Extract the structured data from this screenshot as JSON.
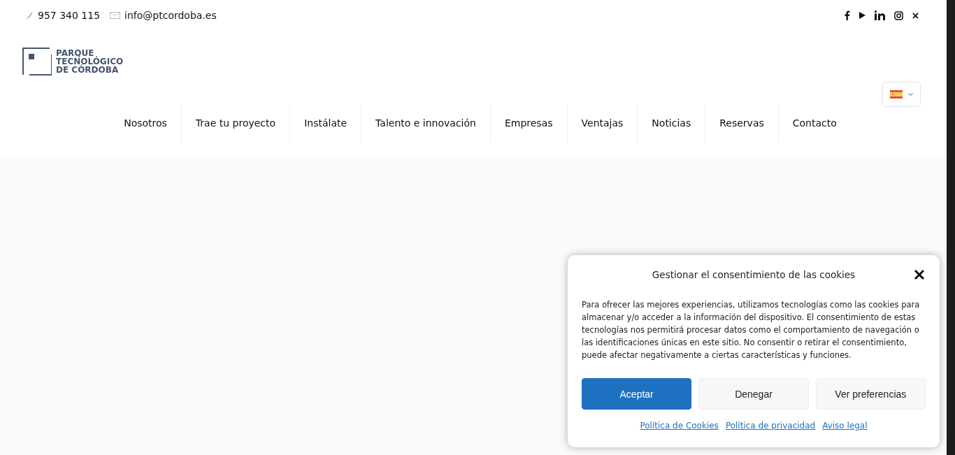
{
  "topbar": {
    "phone": "957 340 115",
    "email": "info@ptcordoba.es",
    "social": [
      {
        "kind": "facebook"
      },
      {
        "kind": "play"
      },
      {
        "kind": "linkedin"
      },
      {
        "kind": "instagram"
      },
      {
        "kind": "x"
      }
    ]
  },
  "logo": {
    "lines": [
      "PARQUE",
      "TECNOLÓGICO",
      "DE CÓRDOBA"
    ]
  },
  "language": {
    "kind": "es"
  },
  "nav": [
    "Nosotros",
    "Trae tu proyecto",
    "Instálate",
    "Talento e innovación",
    "Empresas",
    "Ventajas",
    "Noticias",
    "Reservas",
    "Contacto"
  ],
  "cookie_dialog": {
    "title": "Gestionar el consentimiento de las cookies",
    "body": "Para ofrecer las mejores experiencias, utilizamos tecnologías como las cookies para almacenar y/o acceder a la información del dispositivo. El consentimiento de estas tecnologías nos permitirá procesar datos como el comportamiento de navegación o las identificaciones únicas en este sitio. No consentir o retirar el consentimiento, puede afectar negativamente a ciertas características y funciones.",
    "buttons": [
      {
        "label": "Aceptar",
        "kind": "primary"
      },
      {
        "label": "Denegar",
        "kind": "secondary"
      },
      {
        "label": "Ver preferencias",
        "kind": "secondary"
      }
    ],
    "links": [
      "Política de Cookies",
      "Política de privacidad",
      "Aviso legal"
    ]
  }
}
